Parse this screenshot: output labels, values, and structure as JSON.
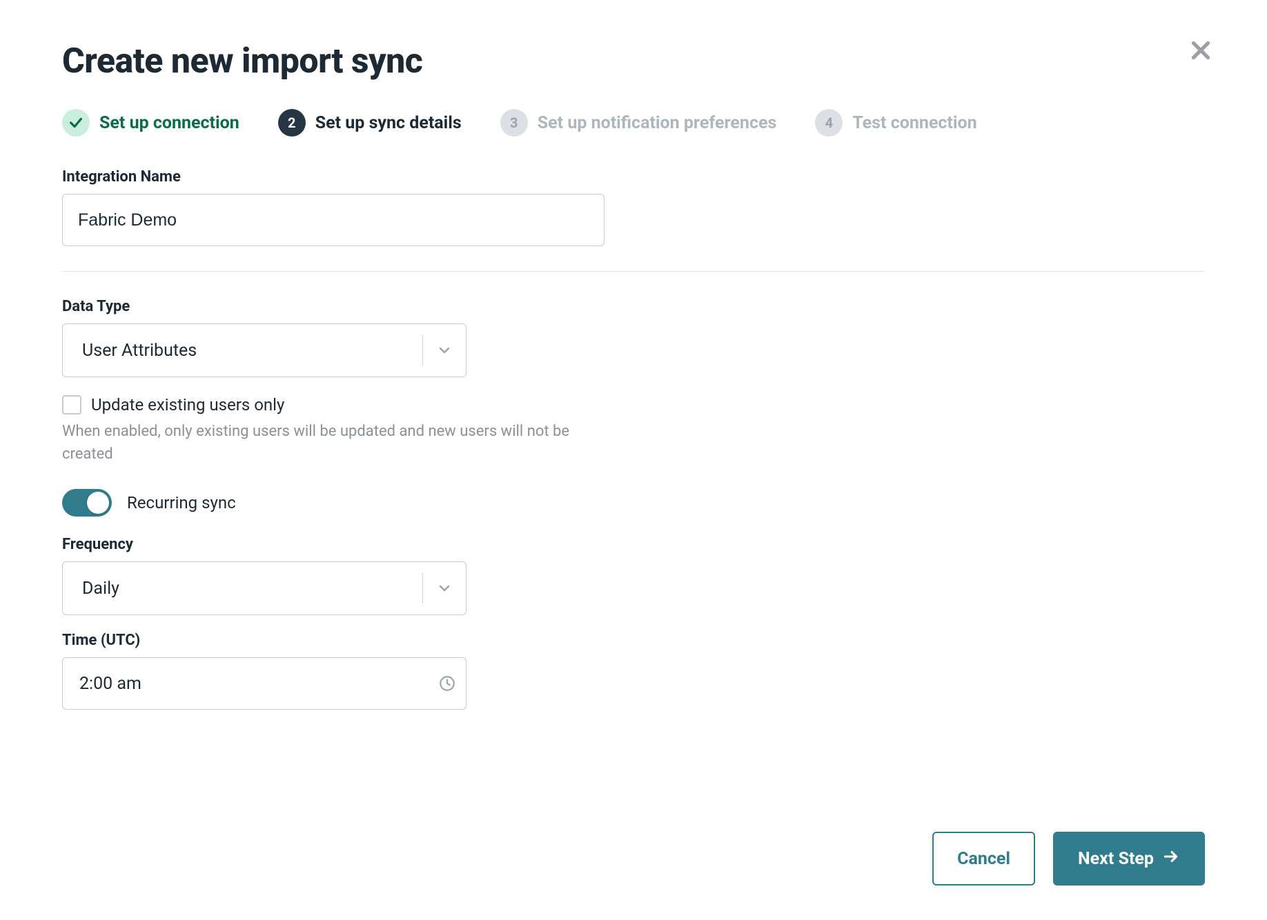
{
  "modal": {
    "title": "Create new import sync"
  },
  "stepper": {
    "items": [
      {
        "num": "1",
        "label": "Set up connection",
        "state": "done"
      },
      {
        "num": "2",
        "label": "Set up sync details",
        "state": "active"
      },
      {
        "num": "3",
        "label": "Set up notification preferences",
        "state": "todo"
      },
      {
        "num": "4",
        "label": "Test connection",
        "state": "todo"
      }
    ]
  },
  "form": {
    "integration_name_label": "Integration Name",
    "integration_name_value": "Fabric Demo",
    "data_type_label": "Data Type",
    "data_type_value": "User Attributes",
    "update_existing_label": "Update existing users only",
    "update_existing_checked": false,
    "update_existing_helper": "When enabled, only existing users will be updated and new users will not be created",
    "recurring_label": "Recurring sync",
    "recurring_on": true,
    "frequency_label": "Frequency",
    "frequency_value": "Daily",
    "time_label": "Time (UTC)",
    "time_value": "2:00 am"
  },
  "footer": {
    "cancel": "Cancel",
    "next": "Next Step"
  },
  "colors": {
    "primary": "#307c8c",
    "text": "#1d2a34",
    "muted": "#9aa4ad",
    "border": "#c5cbd1",
    "step_done_bg": "#c9eedd",
    "step_done_fg": "#0c6b4d"
  }
}
